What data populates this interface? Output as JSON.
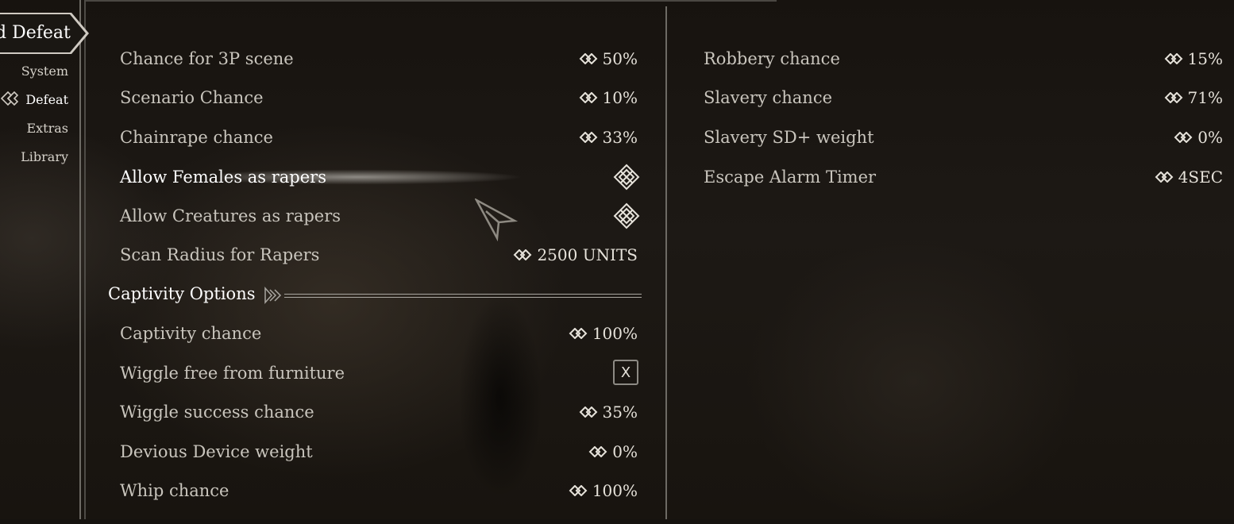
{
  "nav": {
    "mod_title": "d Defeat",
    "items": [
      {
        "label": "System",
        "selected": false
      },
      {
        "label": "Defeat",
        "selected": true
      },
      {
        "label": "Extras",
        "selected": false
      },
      {
        "label": "Library",
        "selected": false
      }
    ]
  },
  "left_column": {
    "rows": [
      {
        "label": "Chance for 3P scene",
        "value": "50%"
      },
      {
        "label": "Scenario Chance",
        "value": "10%"
      },
      {
        "label": "Chainrape chance",
        "value": "33%"
      },
      {
        "label": "Allow Females as rapers",
        "checked": true,
        "highlighted": true
      },
      {
        "label": "Allow Creatures as rapers",
        "checked": true
      },
      {
        "label": "Scan Radius for Rapers",
        "value": "2500 UNITS"
      }
    ],
    "section_header": "Captivity Options",
    "captivity_rows": [
      {
        "label": "Captivity chance",
        "value": "100%"
      },
      {
        "label": "Wiggle free from furniture",
        "key": "X"
      },
      {
        "label": "Wiggle success chance",
        "value": "35%"
      },
      {
        "label": "Devious Device weight",
        "value": "0%"
      },
      {
        "label": "Whip chance",
        "value": "100%"
      }
    ]
  },
  "right_column": {
    "rows": [
      {
        "label": "Robbery chance",
        "value": "15%"
      },
      {
        "label": "Slavery chance",
        "value": "71%"
      },
      {
        "label": "Slavery SD+ weight",
        "value": "0%"
      },
      {
        "label": "Escape Alarm Timer",
        "value": "4SEC"
      }
    ]
  },
  "colors": {
    "text": "#c9c5bd",
    "text_highlight": "#ffffff",
    "divider": "#6d6a64",
    "background": "#16130f"
  },
  "icons": {
    "slider_arrows": "double-arrow-icon",
    "checkbox_checked": "rune-check-icon",
    "section": "section-header-icon",
    "nav_selected": "nav-selected-icon",
    "cursor": "cursor-arrow-icon"
  }
}
